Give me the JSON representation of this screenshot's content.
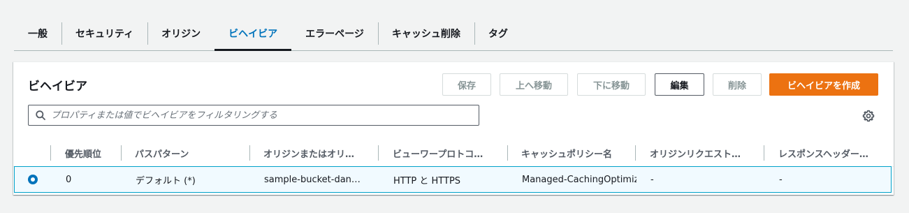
{
  "tabs": [
    {
      "label": "一般",
      "active": false
    },
    {
      "label": "セキュリティ",
      "active": false
    },
    {
      "label": "オリジン",
      "active": false
    },
    {
      "label": "ビヘイビア",
      "active": true
    },
    {
      "label": "エラーページ",
      "active": false
    },
    {
      "label": "キャッシュ削除",
      "active": false
    },
    {
      "label": "タグ",
      "active": false
    }
  ],
  "panel": {
    "title": "ビヘイビア",
    "buttons": {
      "save": "保存",
      "move_up": "上へ移動",
      "move_down": "下に移動",
      "edit": "編集",
      "delete": "削除",
      "create": "ビヘイビアを作成"
    },
    "filter_placeholder": "プロパティまたは値でビヘイビアをフィルタリングする"
  },
  "table": {
    "columns": [
      "優先順位",
      "パスパターン",
      "オリジンまたはオリ…",
      "ビューワープロトコ…",
      "キャッシュポリシー名",
      "オリジンリクエスト…",
      "レスポンスヘッダー…"
    ],
    "rows": [
      {
        "selected": true,
        "cells": [
          "0",
          "デフォルト (*)",
          "sample-bucket-dan…",
          "HTTP と HTTPS",
          "Managed-CachingOptimiz",
          "-",
          "-"
        ]
      }
    ]
  },
  "colors": {
    "accent": "#0073bb",
    "primary_button": "#ec7211",
    "selected_row_border": "#00a1c9",
    "selected_row_bg": "#f1faff"
  },
  "icons": {
    "search": "search-icon",
    "settings": "gear-icon",
    "selected_radio": "radio-selected-icon"
  }
}
